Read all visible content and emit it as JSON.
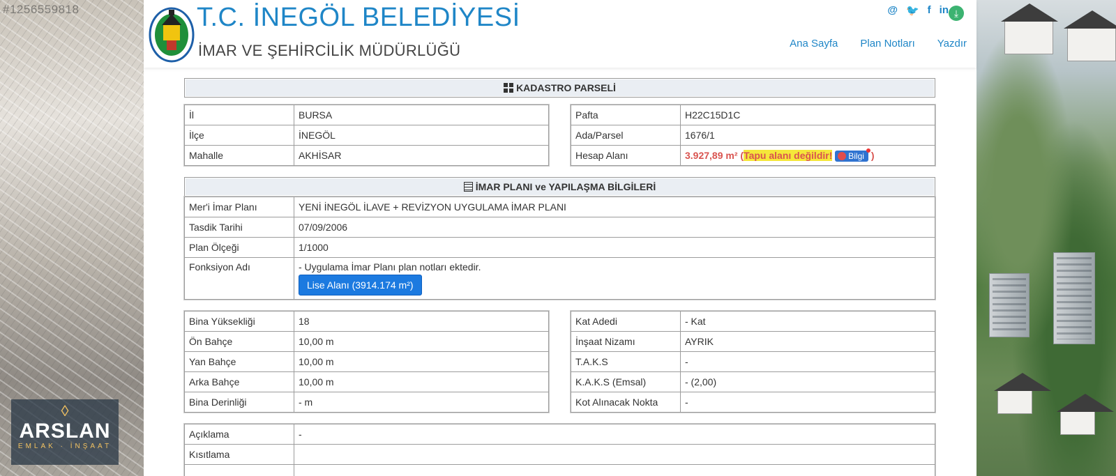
{
  "watermark_id": "#1256559818",
  "header": {
    "title": "T.C. İNEGÖL BELEDİYESİ",
    "subtitle": "İMAR VE ŞEHİRCİLİK MÜDÜRLÜĞÜ",
    "social": [
      {
        "icon": "at-icon",
        "glyph": "@"
      },
      {
        "icon": "twitter-icon",
        "glyph": "🐦"
      },
      {
        "icon": "facebook-icon",
        "glyph": "f"
      },
      {
        "icon": "linkedin-icon",
        "glyph": "in"
      }
    ],
    "nav": [
      "Ana Sayfa",
      "Plan Notları",
      "Yazdır"
    ]
  },
  "kadastro": {
    "heading": "KADASTRO PARSELİ",
    "left": [
      {
        "k": "İl",
        "v": "BURSA"
      },
      {
        "k": "İlçe",
        "v": "İNEGÖL"
      },
      {
        "k": "Mahalle",
        "v": "AKHİSAR"
      }
    ],
    "right": [
      {
        "k": "Pafta",
        "v": "H22C15D1C"
      },
      {
        "k": "Ada/Parsel",
        "v": "1676/1"
      }
    ],
    "hesap": {
      "k": "Hesap Alanı",
      "area": "3.927,89 m²",
      "paren_open": "(",
      "note": "Tapu alanı değildir!",
      "bilgi": "Bilgi",
      "paren_close": ")"
    }
  },
  "imar": {
    "heading": "İMAR PLANI ve YAPILAŞMA BİLGİLERİ",
    "rows": [
      {
        "k": "Mer'i İmar Planı",
        "v": "YENİ İNEGÖL İLAVE + REVİZYON UYGULAMA İMAR PLANI"
      },
      {
        "k": "Tasdik Tarihi",
        "v": "07/09/2006"
      },
      {
        "k": "Plan Ölçeği",
        "v": "1/1000"
      }
    ],
    "fonksiyon": {
      "k": "Fonksiyon Adı",
      "v": "- Uygulama İmar Planı plan notları ektedir.",
      "button": "Lise Alanı (3914.174 m²)"
    }
  },
  "yapilasma": {
    "left": [
      {
        "k": "Bina Yüksekliği",
        "v": "18"
      },
      {
        "k": "Ön Bahçe",
        "v": "10,00 m"
      },
      {
        "k": "Yan Bahçe",
        "v": "10,00 m"
      },
      {
        "k": "Arka Bahçe",
        "v": "10,00 m"
      },
      {
        "k": "Bina Derinliği",
        "v": "- m"
      }
    ],
    "right": [
      {
        "k": "Kat Adedi",
        "v": "- Kat"
      },
      {
        "k": "İnşaat Nizamı",
        "v": "AYRIK"
      },
      {
        "k": "T.A.K.S",
        "v": "-"
      },
      {
        "k": "K.A.K.S (Emsal)",
        "v": "- (2,00)"
      },
      {
        "k": "Kot Alınacak Nokta",
        "v": "-"
      }
    ]
  },
  "aciklama": [
    {
      "k": "Açıklama",
      "v": "-"
    },
    {
      "k": "Kısıtlama",
      "v": ""
    },
    {
      "k": "",
      "v": ""
    }
  ],
  "brand": {
    "name": "ARSLAN",
    "tagline": "EMLAK · İNŞAAT"
  },
  "colors": {
    "accent": "#1f86c7",
    "button": "#1c7ae0",
    "warning": "#d9534f",
    "highlight": "#f5e73a"
  }
}
